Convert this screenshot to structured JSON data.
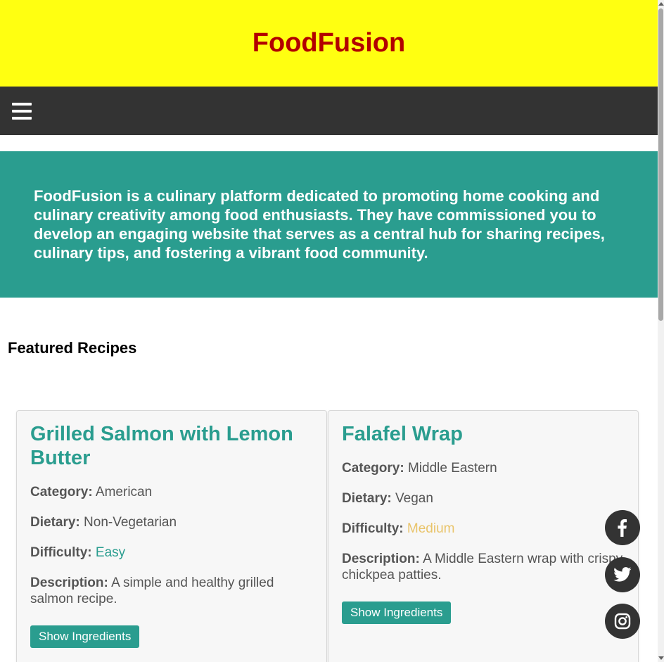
{
  "header": {
    "title": "FoodFusion"
  },
  "nav": {
    "menu_icon": "hamburger-menu-icon"
  },
  "intro": {
    "text": "FoodFusion is a culinary platform dedicated to promoting home cooking and culinary creativity among food enthusiasts. They have commissioned you to develop an engaging website that serves as a central hub for sharing recipes, culinary tips, and fostering a vibrant food community."
  },
  "featured": {
    "heading": "Featured Recipes",
    "recipes": [
      {
        "title": "Grilled Salmon with Lemon Butter",
        "category_label": "Category:",
        "category": "American",
        "dietary_label": "Dietary:",
        "dietary": "Non-Vegetarian",
        "difficulty_label": "Difficulty:",
        "difficulty": "Easy",
        "description_label": "Description:",
        "description": "A simple and healthy grilled salmon recipe.",
        "button": "Show Ingredients"
      },
      {
        "title": "Falafel Wrap",
        "category_label": "Category:",
        "category": "Middle Eastern",
        "dietary_label": "Dietary:",
        "dietary": "Vegan",
        "difficulty_label": "Difficulty:",
        "difficulty": "Medium",
        "description_label": "Description:",
        "description": "A Middle Eastern wrap with crispy chickpea patties.",
        "button": "Show Ingredients"
      }
    ]
  },
  "social": [
    "facebook-icon",
    "twitter-icon",
    "instagram-icon"
  ],
  "colors": {
    "header_bg": "#ffff11",
    "title": "#b20000",
    "nav_bg": "#333333",
    "accent": "#2a9d8f",
    "medium": "#e9c46a"
  }
}
